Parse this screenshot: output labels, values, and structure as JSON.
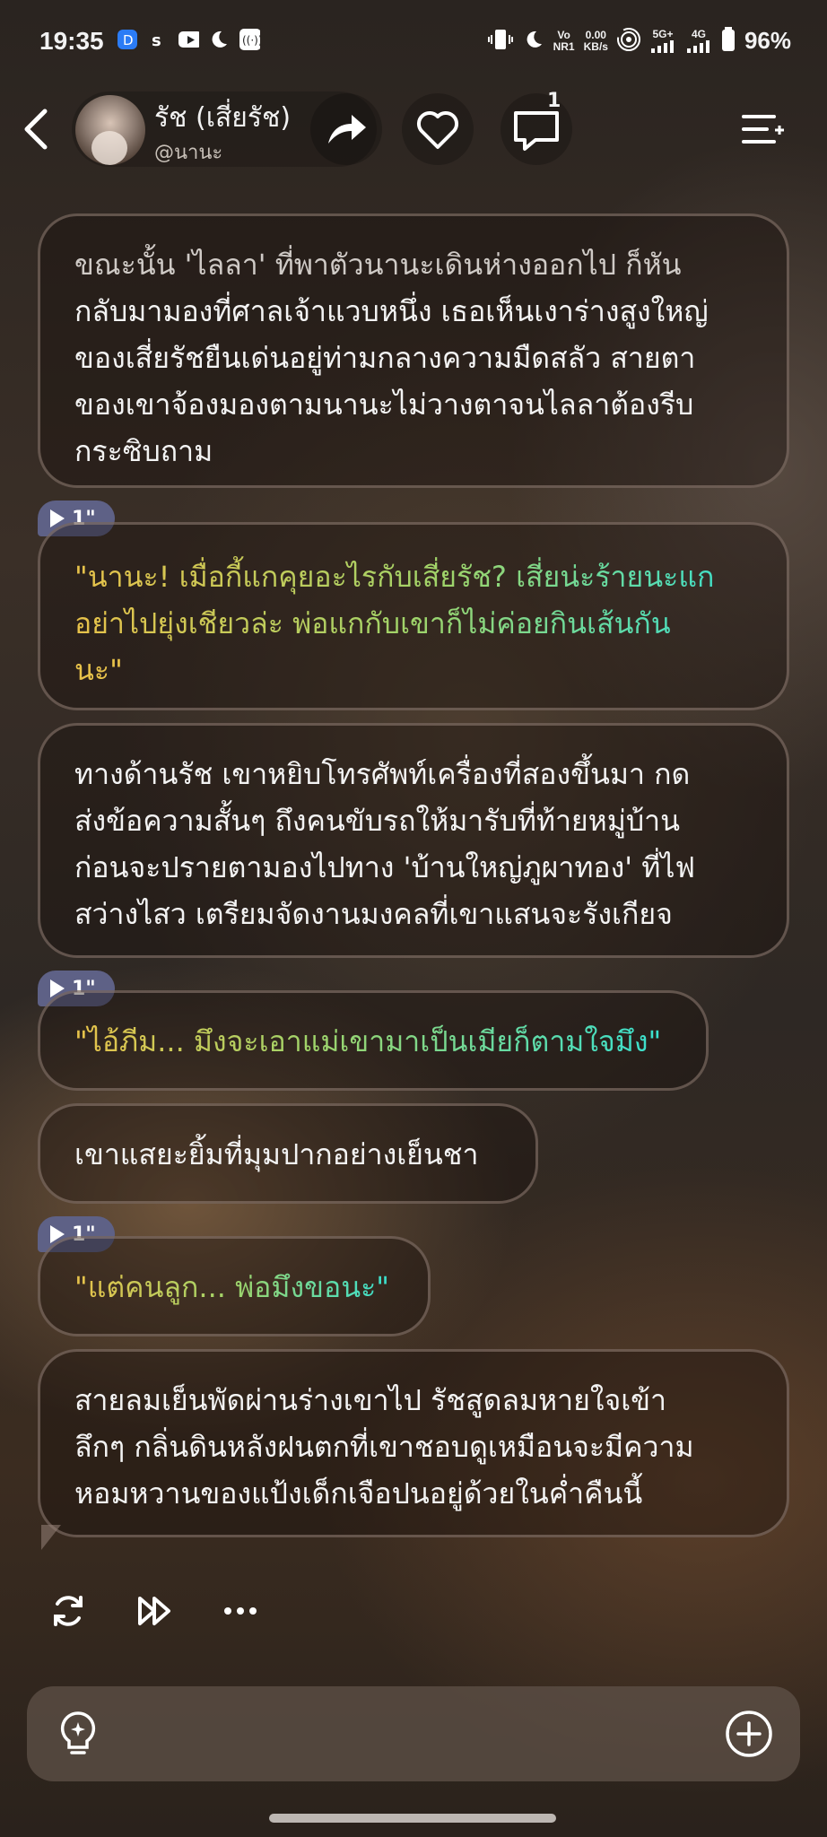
{
  "status": {
    "time": "19:35",
    "net_top": "Vo",
    "net_bottom": "NR1",
    "speed_top": "0.00",
    "speed_bottom": "KB/s",
    "g5": "5G+",
    "g4": "4G",
    "battery": "96%"
  },
  "header": {
    "name": "รัช (เสี่ยรัช)",
    "handle": "@นานะ",
    "comment_count": "1"
  },
  "messages": [
    {
      "type": "narration",
      "text": "ขณะนั้น 'ไลลา' ที่พาตัวนานะเดินห่างออกไป ก็หันกลับมามองที่ศาลเจ้าแวบหนึ่ง เธอเห็นเงาร่างสูงใหญ่ของเสี่ยรัชยืนเด่นอยู่ท่ามกลางความมืดสลัว สายตาของเขาจ้องมองตามนานะไม่วางตาจนไลลาต้องรีบกระซิบถาม"
    },
    {
      "type": "dialogue",
      "duration": "1\"",
      "text": "\"นานะ! เมื่อกี้แกคุยอะไรกับเสี่ยรัช? เสี่ยน่ะร้ายนะแก อย่าไปยุ่งเชียวล่ะ พ่อแกกับเขาก็ไม่ค่อยกินเส้นกันนะ\""
    },
    {
      "type": "narration",
      "text": "ทางด้านรัช เขาหยิบโทรศัพท์เครื่องที่สองขึ้นมา กดส่งข้อความสั้นๆ ถึงคนขับรถให้มารับที่ท้ายหมู่บ้าน ก่อนจะปรายตามองไปทาง 'บ้านใหญ่ภูผาทอง' ที่ไฟสว่างไสว เตรียมจัดงานมงคลที่เขาแสนจะรังเกียจ"
    },
    {
      "type": "dialogue",
      "duration": "1\"",
      "text": "\"ไอ้ภีม... มึงจะเอาแม่เขามาเป็นเมียก็ตามใจมึง\""
    },
    {
      "type": "narration",
      "text": "เขาแสยะยิ้มที่มุมปากอย่างเย็นชา"
    },
    {
      "type": "dialogue",
      "duration": "1\"",
      "text": "\"แต่คนลูก... พ่อมึงขอนะ\""
    },
    {
      "type": "narration",
      "text": "สายลมเย็นพัดผ่านร่างเขาไป รัชสูดลมหายใจเข้าลึกๆ กลิ่นดินหลังฝนตกที่เขาชอบดูเหมือนจะมีความหอมหวานของแป้งเด็กเจือปนอยู่ด้วยในค่ำคืนนี้"
    }
  ],
  "lines": {
    "m0": [
      "ขณะนั้น 'ไลลา' ที่พาตัวนานะเดินห่างออกไป ก็หัน",
      "กลับมามองที่ศาลเจ้าแวบหนึ่ง เธอเห็นเงาร่างสูงใหญ่",
      "ของเสี่ยรัชยืนเด่นอยู่ท่ามกลางความมืดสลัว สายตา",
      "ของเขาจ้องมองตามนานะไม่วางตาจนไลลาต้องรีบ",
      "กระซิบถาม"
    ],
    "m1": [
      "\"นานะ! เมื่อกี้แกคุยอะไรกับเสี่ยรัช? เสี่ยน่ะร้ายนะแก",
      "อย่าไปยุ่งเชียวล่ะ พ่อแกกับเขาก็ไม่ค่อยกินเส้นกัน",
      "นะ\""
    ],
    "m2": [
      "ทางด้านรัช เขาหยิบโทรศัพท์เครื่องที่สองขึ้นมา กด",
      "ส่งข้อความสั้นๆ ถึงคนขับรถให้มารับที่ท้ายหมู่บ้าน",
      "ก่อนจะปรายตามองไปทาง 'บ้านใหญ่ภูผาทอง' ที่ไฟ",
      "สว่างไสว เตรียมจัดงานมงคลที่เขาแสนจะรังเกียจ"
    ],
    "m3": [
      "\"ไอ้ภีม... มึงจะเอาแม่เขามาเป็นเมียก็ตามใจมึง\""
    ],
    "m4": [
      "เขาแสยะยิ้มที่มุมปากอย่างเย็นชา"
    ],
    "m5": [
      "\"แต่คนลูก... พ่อมึงขอนะ\""
    ],
    "m6": [
      "สายลมเย็นพัดผ่านร่างเขาไป รัชสูดลมหายใจเข้า",
      "ลึกๆ กลิ่นดินหลังฝนตกที่เขาชอบดูเหมือนจะมีความ",
      "หอมหวานของแป้งเด็กเจือปนอยู่ด้วยในค่ำคืนนี้"
    ]
  },
  "colors": {
    "dialog_gradient": [
      "#e8c24a",
      "#8fd36a",
      "#36e0d2"
    ],
    "play_chip": "#5e6186"
  }
}
